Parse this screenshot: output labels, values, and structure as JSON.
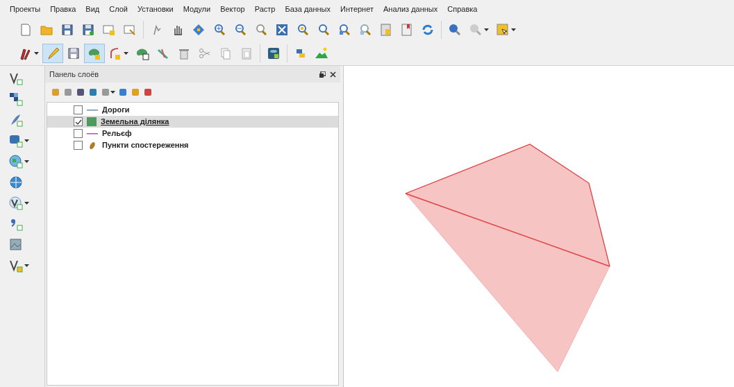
{
  "menu": [
    {
      "label": "Проекты"
    },
    {
      "label": "Правка"
    },
    {
      "label": "Вид"
    },
    {
      "label": "Слой"
    },
    {
      "label": "Установки"
    },
    {
      "label": "Модули"
    },
    {
      "label": "Вектор"
    },
    {
      "label": "Растр"
    },
    {
      "label": "База данных"
    },
    {
      "label": "Интернет"
    },
    {
      "label": "Анализ данных"
    },
    {
      "label": "Справка"
    }
  ],
  "edit_toolbar": [
    {
      "selected": false
    },
    {
      "selected": true
    },
    {
      "selected": false
    },
    {
      "selected": true
    },
    {
      "selected": false
    },
    {
      "selected": false
    },
    {
      "selected": false
    },
    {
      "selected": false
    },
    {
      "selected": false
    },
    {
      "selected": false
    },
    {
      "selected": false
    }
  ],
  "layers_panel": {
    "title": "Панель слоёв",
    "layers": [
      {
        "name": "Дороги",
        "checked": false,
        "selected": false,
        "kind": "line",
        "color": "#6f8fa8"
      },
      {
        "name": "Земельна ділянка",
        "checked": true,
        "selected": true,
        "kind": "polygon",
        "color": "#4e9a5e"
      },
      {
        "name": "Рельєф",
        "checked": false,
        "selected": false,
        "kind": "line",
        "color": "#b04fc0"
      },
      {
        "name": "Пункти спостереження",
        "checked": false,
        "selected": false,
        "kind": "point",
        "color": "#b07a2a"
      }
    ]
  }
}
